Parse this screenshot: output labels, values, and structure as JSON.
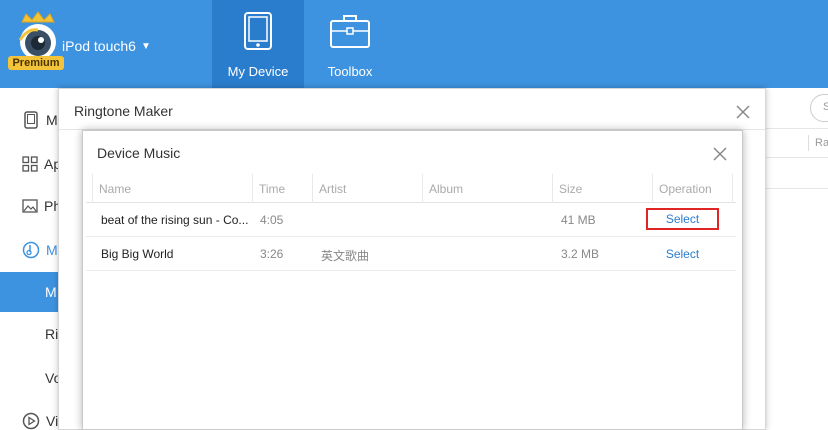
{
  "header": {
    "device_name": "iPod touch6",
    "logo_badge": "Premium",
    "tabs": [
      {
        "label": "My Device",
        "icon": "tablet-icon",
        "active": true
      },
      {
        "label": "Toolbox",
        "icon": "toolbox-icon",
        "active": false
      }
    ]
  },
  "sidebar": {
    "items": [
      {
        "label": "M",
        "icon": "phone-icon"
      },
      {
        "label": "Ap",
        "icon": "apps-grid-icon"
      },
      {
        "label": "Ph",
        "icon": "photo-icon"
      },
      {
        "label": "M",
        "icon": "music-icon"
      },
      {
        "label": "M",
        "sub": true,
        "active": true
      },
      {
        "label": "Ri",
        "sub": true
      },
      {
        "label": "Vo",
        "sub": true
      },
      {
        "label": "Vi",
        "icon": "video-icon"
      }
    ]
  },
  "background": {
    "search_placeholder": "S",
    "column_partial": "Ra"
  },
  "ringtone_maker": {
    "title": "Ringtone Maker"
  },
  "device_music": {
    "title": "Device Music",
    "columns": [
      "Name",
      "Time",
      "Artist",
      "Album",
      "Size",
      "Operation"
    ],
    "rows": [
      {
        "name": "beat of the rising sun - Co...",
        "time": "4:05",
        "artist": "",
        "album": "",
        "size": "41 MB",
        "operation": "Select",
        "highlighted": true
      },
      {
        "name": "Big Big World",
        "time": "3:26",
        "artist": "英文歌曲",
        "album": "",
        "size": "3.2 MB",
        "operation": "Select",
        "highlighted": false
      }
    ]
  },
  "colors": {
    "topbar": "#3e93e0",
    "active_tab": "#2a7dcc",
    "link": "#2a7dcc",
    "highlight_border": "#e02525"
  }
}
